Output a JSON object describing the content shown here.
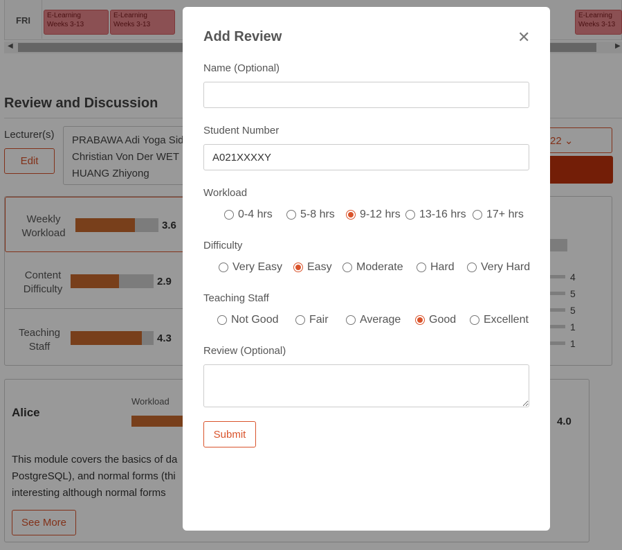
{
  "timetable": {
    "day": "FRI",
    "blocks": [
      {
        "title": "E-Learning",
        "weeks": "Weeks 3-13"
      },
      {
        "title": "E-Learning",
        "weeks": "Weeks 3-13"
      },
      {
        "title": "E-Learning",
        "weeks": "Weeks 3-13"
      }
    ]
  },
  "review_section": {
    "title": "Review and Discussion",
    "lecturer_label": "Lecturer(s)",
    "edit_label": "Edit",
    "lecturers": [
      "PRABAWA Adi Yoga Sid",
      "Christian Von Der WET",
      "HUANG Zhiyong"
    ],
    "semester_value": "22",
    "ratings": [
      {
        "label_line1": "Weekly",
        "label_line2": "Workload",
        "value": "3.6",
        "fraction": 0.72
      },
      {
        "label_line1": "Content",
        "label_line2": "Difficulty",
        "value": "2.9",
        "fraction": 0.58
      },
      {
        "label_line1": "Teaching",
        "label_line2": "Staff",
        "value": "4.3",
        "fraction": 0.86
      }
    ],
    "distribution_counts": [
      "4",
      "5",
      "5",
      "1",
      "1"
    ]
  },
  "review_card": {
    "name": "Alice",
    "workload_label": "Workload",
    "score": "4.0",
    "text_lines": [
      "This module covers the basics of da",
      "PostgreSQL), and normal forms (thi",
      "interesting although normal forms "
    ],
    "see_more_label": "See More"
  },
  "modal": {
    "title": "Add Review",
    "close_icon": "close-icon",
    "name_label": "Name (Optional)",
    "name_value": "",
    "student_number_label": "Student Number",
    "student_number_value": "A021XXXXY",
    "workload_label": "Workload",
    "workload_options": [
      "0-4 hrs",
      "5-8 hrs",
      "9-12 hrs",
      "13-16 hrs",
      "17+ hrs"
    ],
    "workload_selected": "9-12 hrs",
    "difficulty_label": "Difficulty",
    "difficulty_options": [
      "Very Easy",
      "Easy",
      "Moderate",
      "Hard",
      "Very Hard"
    ],
    "difficulty_selected": "Easy",
    "teaching_label": "Teaching Staff",
    "teaching_options": [
      "Not Good",
      "Fair",
      "Average",
      "Good",
      "Excellent"
    ],
    "teaching_selected": "Good",
    "review_label": "Review (Optional)",
    "review_value": "",
    "submit_label": "Submit"
  },
  "colors": {
    "accent": "#d9532b",
    "bar": "#c8692e",
    "overlay": "rgba(0,0,0,0.4)"
  }
}
